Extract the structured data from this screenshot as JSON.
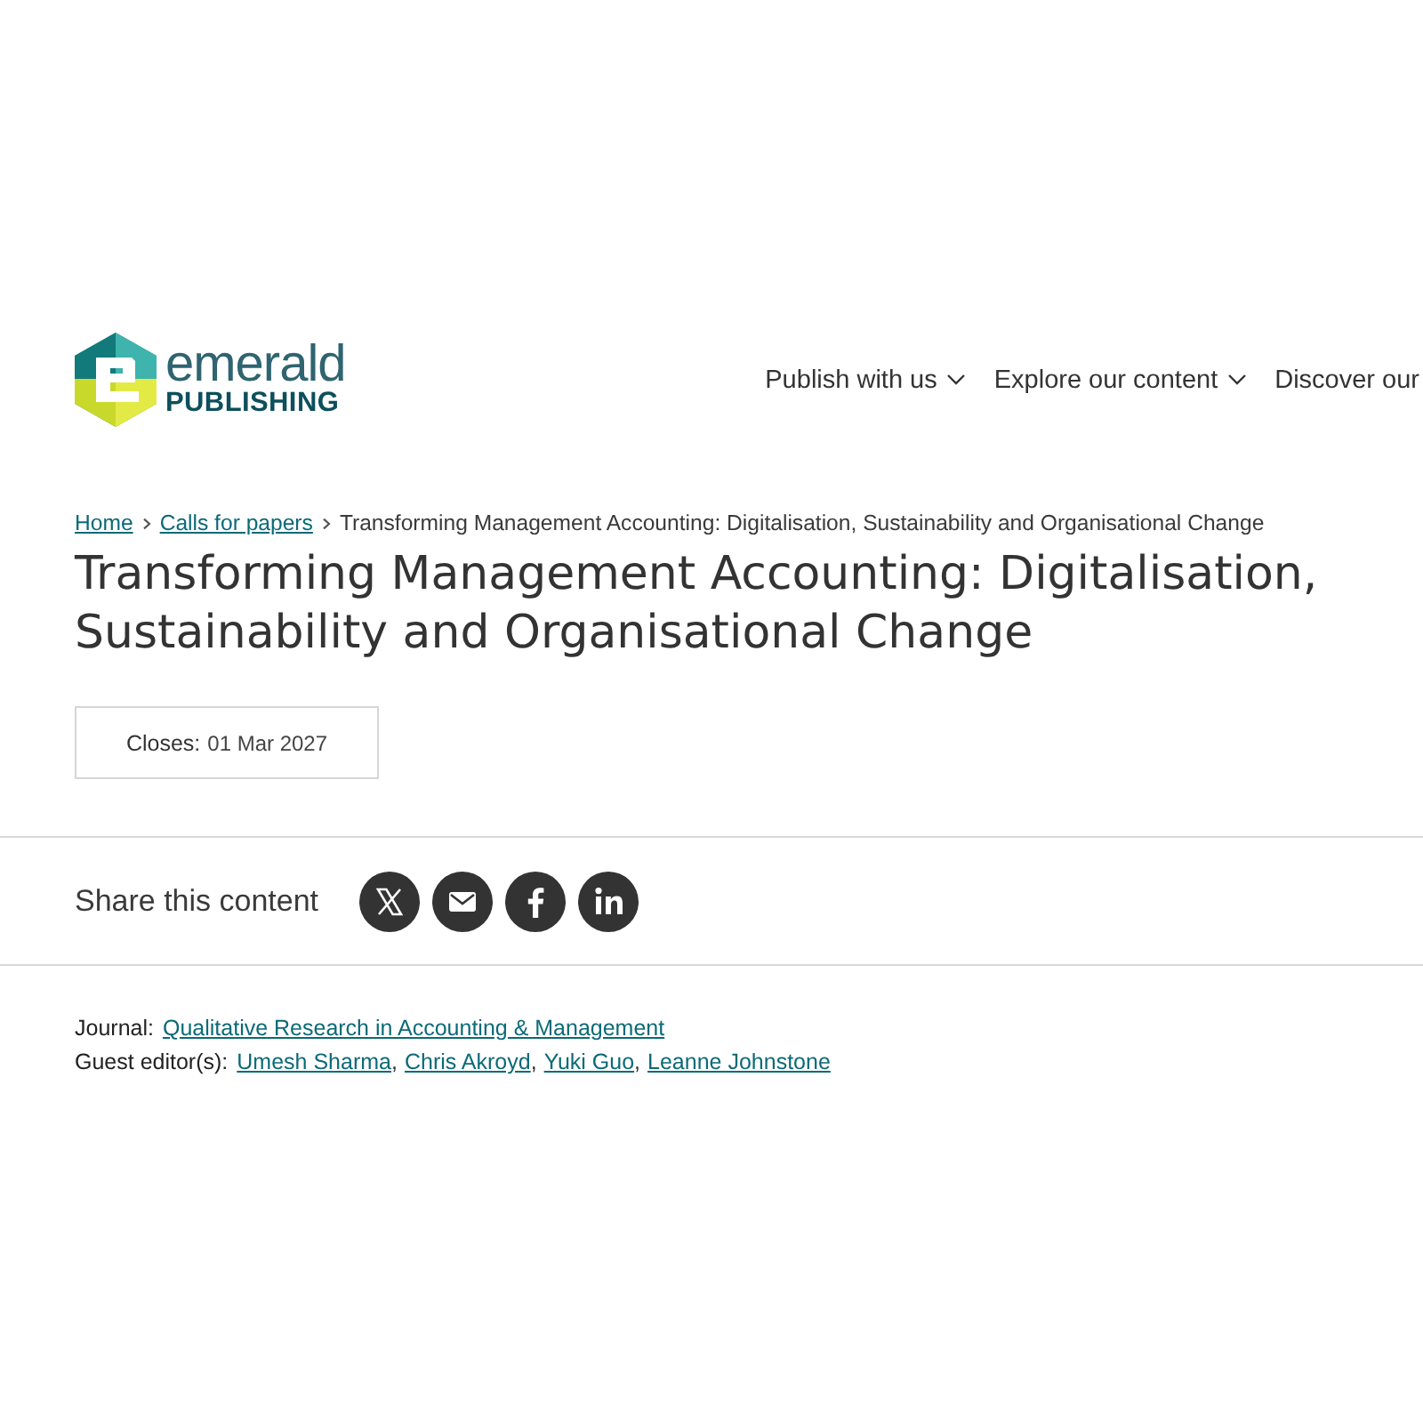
{
  "header": {
    "logo": {
      "word": "emerald",
      "subword": "PUBLISHING"
    },
    "nav": [
      {
        "label": "Publish with us",
        "dropdown": true
      },
      {
        "label": "Explore our content",
        "dropdown": true
      },
      {
        "label": "Discover our",
        "dropdown": false
      }
    ]
  },
  "breadcrumb": [
    {
      "label": "Home",
      "link": true
    },
    {
      "label": "Calls for papers",
      "link": true
    },
    {
      "label": "Transforming Management Accounting: Digitalisation, Sustainability and Organisational Change",
      "link": false
    }
  ],
  "title": "Transforming Management Accounting: Digitalisation, Sustainability and Organisational Change",
  "closes": {
    "label": "Closes:",
    "value": "01 Mar 2027"
  },
  "share": {
    "label": "Share this content",
    "buttons": [
      {
        "kind": "x"
      },
      {
        "kind": "email"
      },
      {
        "kind": "facebook"
      },
      {
        "kind": "linkedin"
      }
    ]
  },
  "details": [
    {
      "label": "Journal:",
      "links": [
        {
          "text": "Qualitative Research in Accounting & Management"
        }
      ]
    },
    {
      "label": "Guest editor(s):",
      "links": [
        {
          "text": "Umesh Sharma",
          "separator": ","
        },
        {
          "text": "Chris Akroyd",
          "separator": ","
        },
        {
          "text": "Yuki Guo",
          "separator": ","
        },
        {
          "text": "Leanne Johnstone"
        }
      ]
    }
  ]
}
